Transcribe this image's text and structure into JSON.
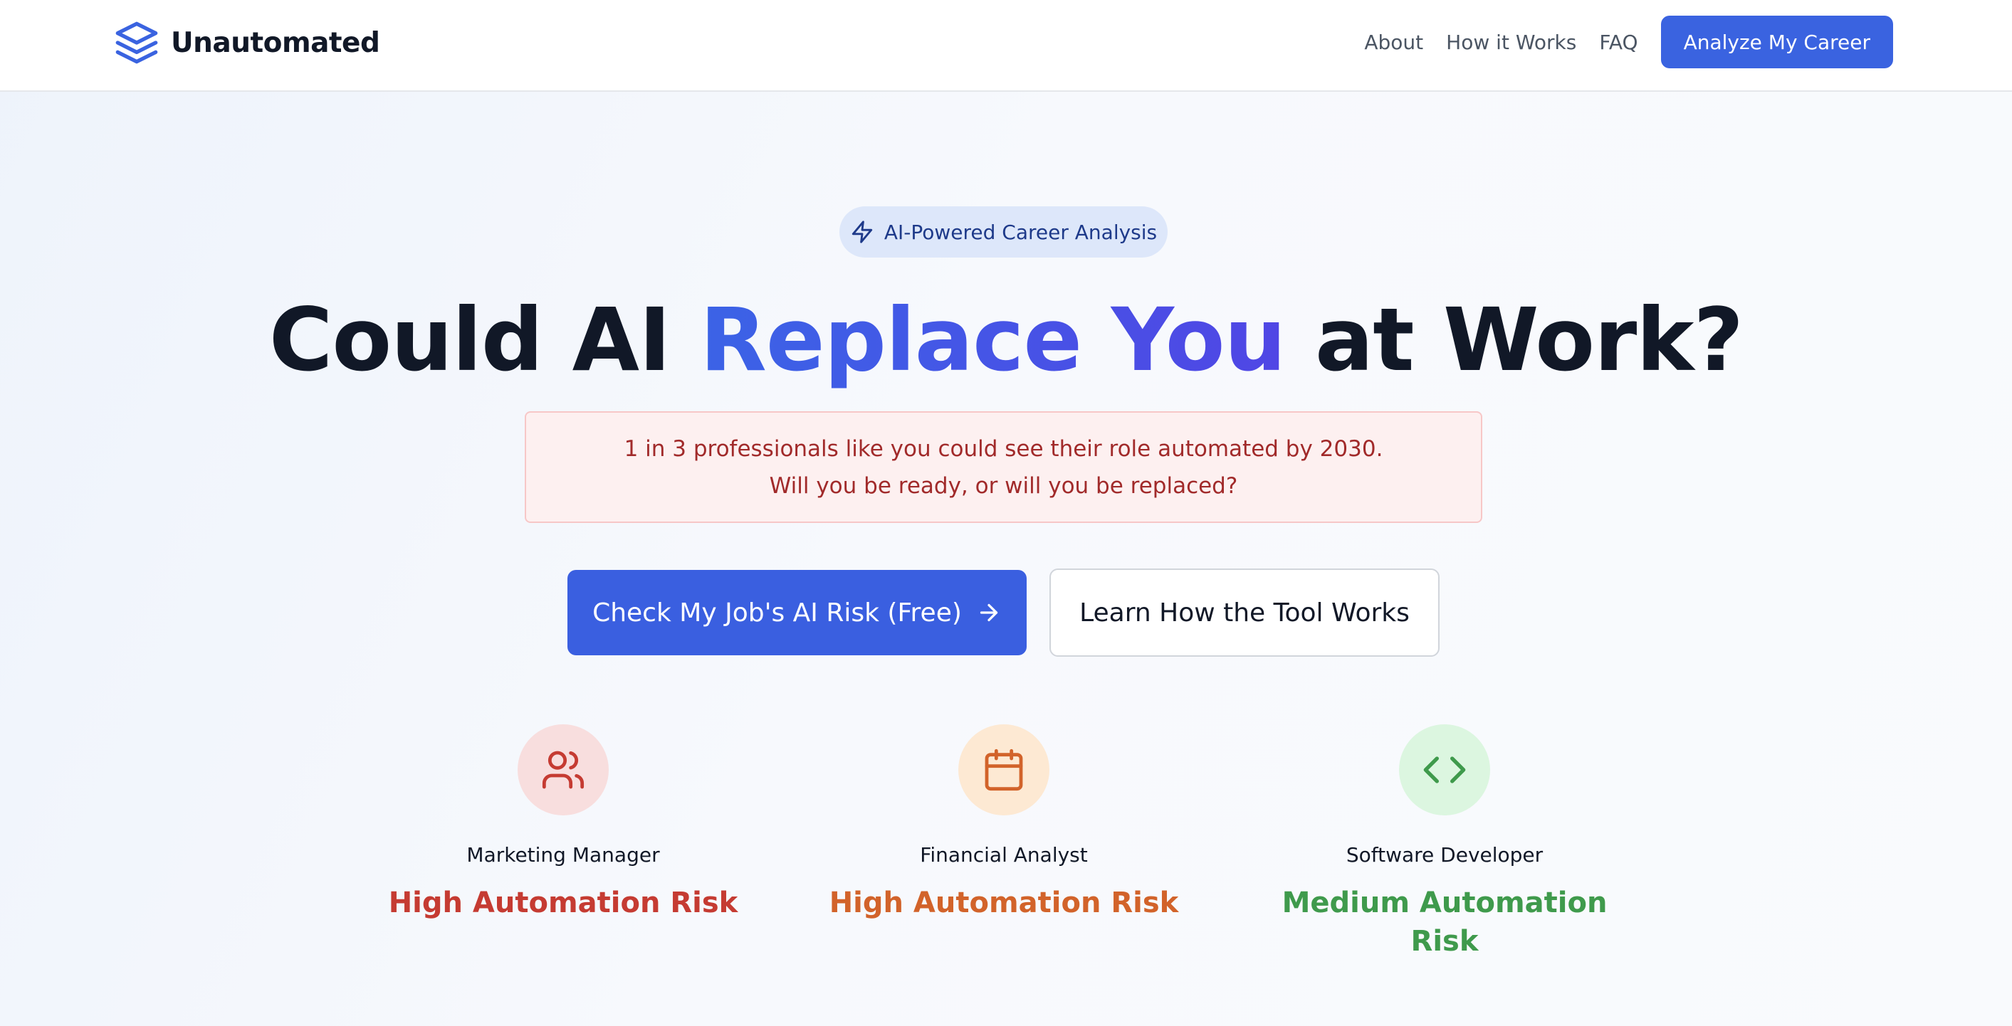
{
  "header": {
    "brand": "Unautomated",
    "nav": [
      "About",
      "How it Works",
      "FAQ"
    ],
    "cta": "Analyze My Career"
  },
  "hero": {
    "badge": "AI-Powered Career Analysis",
    "headline_prefix": "Could AI ",
    "headline_accent": "Replace You",
    "headline_suffix": " at Work?",
    "alert_line1": "1 in 3 professionals like you could see their role automated by 2030.",
    "alert_line2": "Will you be ready, or will you be replaced?",
    "primary_button": "Check My Job's AI Risk (Free)",
    "secondary_button": "Learn How the Tool Works"
  },
  "cards": [
    {
      "job": "Marketing Manager",
      "risk": "High Automation Risk",
      "icon": "users-icon",
      "color": "#c53b32",
      "bg": "#f8dede"
    },
    {
      "job": "Financial Analyst",
      "risk": "High Automation Risk",
      "icon": "calendar-icon",
      "color": "#d2632a",
      "bg": "#fde9d3"
    },
    {
      "job": "Software Developer",
      "risk": "Medium Automation Risk",
      "icon": "code-icon",
      "color": "#3f9a4c",
      "bg": "#dcf6e0"
    }
  ],
  "colors": {
    "primary": "#3a63e0",
    "accent_gradient_start": "#3b63e6",
    "accent_gradient_end": "#5046e5"
  }
}
